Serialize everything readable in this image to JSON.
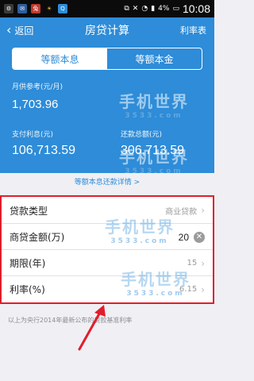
{
  "status_bar": {
    "battery": "4%",
    "time": "10:08",
    "icons": [
      "settings-icon",
      "notification-icon",
      "app-icon",
      "weather-icon",
      "qq-icon"
    ]
  },
  "header": {
    "back_label": "返回",
    "title": "房贷计算",
    "rate_table_label": "利率表"
  },
  "tabs": [
    {
      "label": "等额本息",
      "active": true
    },
    {
      "label": "等额本金",
      "active": false
    }
  ],
  "summary": {
    "monthly_label": "月供参考(元/月)",
    "monthly_value": "1,703.96",
    "interest_label": "支付利息(元)",
    "interest_value": "106,713.59",
    "total_label": "还款总额(元)",
    "total_value": "306,713.59"
  },
  "detail_link": "等额本息还款详情 >",
  "form": {
    "loan_type_label": "贷款类型",
    "loan_type_value": "商业贷款",
    "amount_label": "商贷金额(万)",
    "amount_value": "20",
    "term_label": "期限(年)",
    "term_value": "15",
    "rate_label": "利率(%)",
    "rate_value": "6.15"
  },
  "footnote": "以上为央行2014年最新公布的贷款基准利率",
  "watermark": {
    "text": "手机世界",
    "sub": "3533.com"
  },
  "colors": {
    "accent": "#2e8cd8",
    "highlight": "#e11d2b"
  }
}
